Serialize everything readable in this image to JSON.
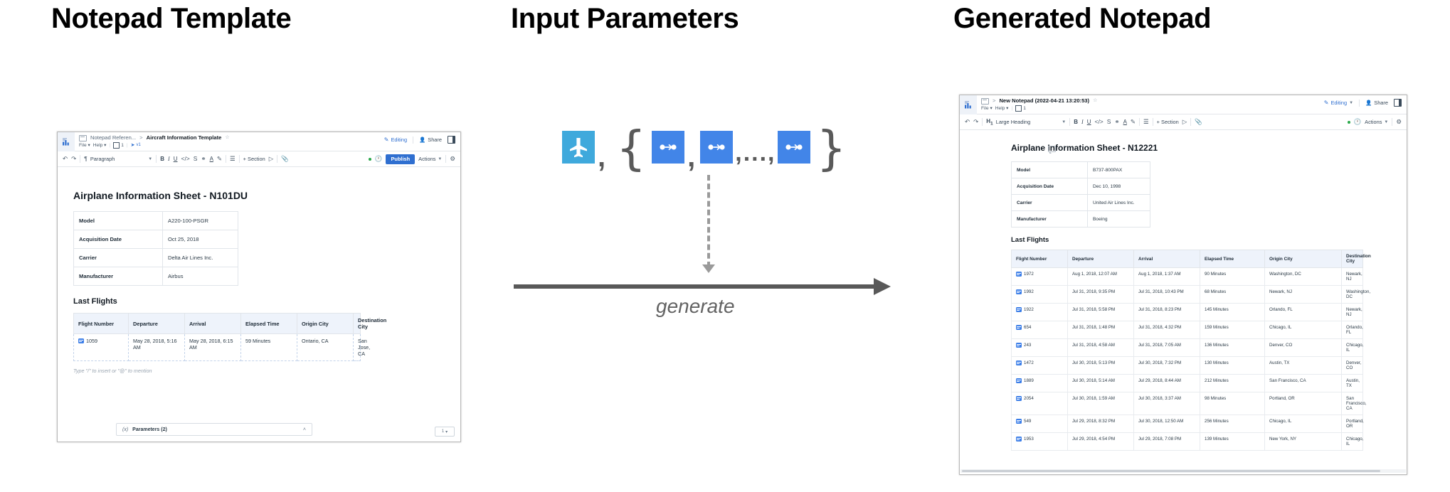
{
  "headings": {
    "left": "Notepad Template",
    "middle": "Input Parameters",
    "right": "Generated Notepad"
  },
  "flow": {
    "generate_label": "generate",
    "ellipsis": ",...,",
    "comma": ",",
    "brace_open": "{",
    "brace_close": "}",
    "icons": {
      "airplane": "airplane-icon",
      "flight": "flight-route-icon",
      "airplane_color": "#3fa9dc",
      "flight_color": "#4285e8"
    },
    "flight_icon_count": 3
  },
  "left_window": {
    "breadcrumb": {
      "parent": "Notepad Referen...",
      "separator": ">",
      "current": "Aircraft Information Template",
      "star": "☆"
    },
    "menu": {
      "file": "File",
      "help": "Help",
      "collab_count": "1",
      "version": "v1"
    },
    "header_actions": {
      "editing": "Editing",
      "share": "Share"
    },
    "toolbar": {
      "style": "Paragraph",
      "bold": "B",
      "italic": "I",
      "underline": "U",
      "code": "</>",
      "strike": "S",
      "link": "⚭",
      "text_color": "A",
      "highlight": "✎",
      "align": "☰",
      "section": "+ Section",
      "publish": "Publish",
      "actions": "Actions"
    },
    "document": {
      "title": "Airplane Information Sheet - N101DU",
      "info_rows": [
        {
          "key": "Model",
          "value": "A220-100-PSGR"
        },
        {
          "key": "Acquisition Date",
          "value": "Oct 25, 2018"
        },
        {
          "key": "Carrier",
          "value": "Delta Air Lines Inc."
        },
        {
          "key": "Manufacturer",
          "value": "Airbus"
        }
      ],
      "section_title": "Last Flights",
      "flight_headers": [
        "Flight Number",
        "Departure",
        "Arrival",
        "Elapsed Time",
        "Origin City",
        "Destination City"
      ],
      "flights": [
        {
          "number": "1059",
          "departure": "May 28, 2018, 5:16 AM",
          "arrival": "May 28, 2018, 6:15 AM",
          "elapsed": "59 Minutes",
          "origin": "Ontario, CA",
          "destination": "San Jose, CA"
        }
      ],
      "placeholder": "Type \"/\" to insert or \"@\" to mention",
      "selection_count": "1"
    },
    "parameters_bar": {
      "fx": "(x)",
      "label": "Parameters (2)",
      "chevron": "˄"
    }
  },
  "right_window": {
    "breadcrumb": {
      "separator": ">",
      "current": "New Notepad (2022-04-21 13:20:53)",
      "star": "☆"
    },
    "menu": {
      "file": "File",
      "help": "Help",
      "collab_count": "1"
    },
    "header_actions": {
      "editing": "Editing",
      "share": "Share"
    },
    "toolbar": {
      "style": "Large Heading",
      "style_prefix": "H",
      "style_sub": "1",
      "bold": "B",
      "italic": "I",
      "underline": "U",
      "code": "</>",
      "strike": "S",
      "link": "⚭",
      "text_color": "A",
      "highlight": "✎",
      "align": "☰",
      "section": "+ Section",
      "actions": "Actions"
    },
    "document": {
      "title": "Airplane Information Sheet - N12221",
      "info_rows": [
        {
          "key": "Model",
          "value": "B737-800PAX"
        },
        {
          "key": "Acquisition Date",
          "value": "Dec 10, 1998"
        },
        {
          "key": "Carrier",
          "value": "United Air Lines Inc."
        },
        {
          "key": "Manufacturer",
          "value": "Boeing"
        }
      ],
      "section_title": "Last Flights",
      "flight_headers": [
        "Flight Number",
        "Departure",
        "Arrival",
        "Elapsed Time",
        "Origin City",
        "Destination City"
      ],
      "flights": [
        {
          "number": "1972",
          "departure": "Aug 1, 2018, 12:07 AM",
          "arrival": "Aug 1, 2018, 1:37 AM",
          "elapsed": "90 Minutes",
          "origin": "Washington, DC",
          "destination": "Newark, NJ"
        },
        {
          "number": "1992",
          "departure": "Jul 31, 2018, 9:35 PM",
          "arrival": "Jul 31, 2018, 10:43 PM",
          "elapsed": "68 Minutes",
          "origin": "Newark, NJ",
          "destination": "Washington, DC"
        },
        {
          "number": "1922",
          "departure": "Jul 31, 2018, 5:58 PM",
          "arrival": "Jul 31, 2018, 8:23 PM",
          "elapsed": "145 Minutes",
          "origin": "Orlando, FL",
          "destination": "Newark, NJ"
        },
        {
          "number": "654",
          "departure": "Jul 31, 2018, 1:48 PM",
          "arrival": "Jul 31, 2018, 4:32 PM",
          "elapsed": "159 Minutes",
          "origin": "Chicago, IL",
          "destination": "Orlando, FL"
        },
        {
          "number": "243",
          "departure": "Jul 31, 2018, 4:58 AM",
          "arrival": "Jul 31, 2018, 7:05 AM",
          "elapsed": "136 Minutes",
          "origin": "Denver, CO",
          "destination": "Chicago, IL"
        },
        {
          "number": "1472",
          "departure": "Jul 30, 2018, 5:13 PM",
          "arrival": "Jul 30, 2018, 7:32 PM",
          "elapsed": "130 Minutes",
          "origin": "Austin, TX",
          "destination": "Denver, CO"
        },
        {
          "number": "1889",
          "departure": "Jul 30, 2018, 5:14 AM",
          "arrival": "Jul 29, 2018, 8:44 AM",
          "elapsed": "212 Minutes",
          "origin": "San Francisco, CA",
          "destination": "Austin, TX"
        },
        {
          "number": "2054",
          "departure": "Jul 30, 2018, 1:59 AM",
          "arrival": "Jul 30, 2018, 3:37 AM",
          "elapsed": "98 Minutes",
          "origin": "Portland, OR",
          "destination": "San Francisco, CA"
        },
        {
          "number": "549",
          "departure": "Jul 29, 2018, 8:32 PM",
          "arrival": "Jul 30, 2018, 12:50 AM",
          "elapsed": "256 Minutes",
          "origin": "Chicago, IL",
          "destination": "Portland, OR"
        },
        {
          "number": "1953",
          "departure": "Jul 29, 2018, 4:54 PM",
          "arrival": "Jul 29, 2018, 7:08 PM",
          "elapsed": "139 Minutes",
          "origin": "New York, NY",
          "destination": "Chicago, IL"
        }
      ]
    }
  }
}
